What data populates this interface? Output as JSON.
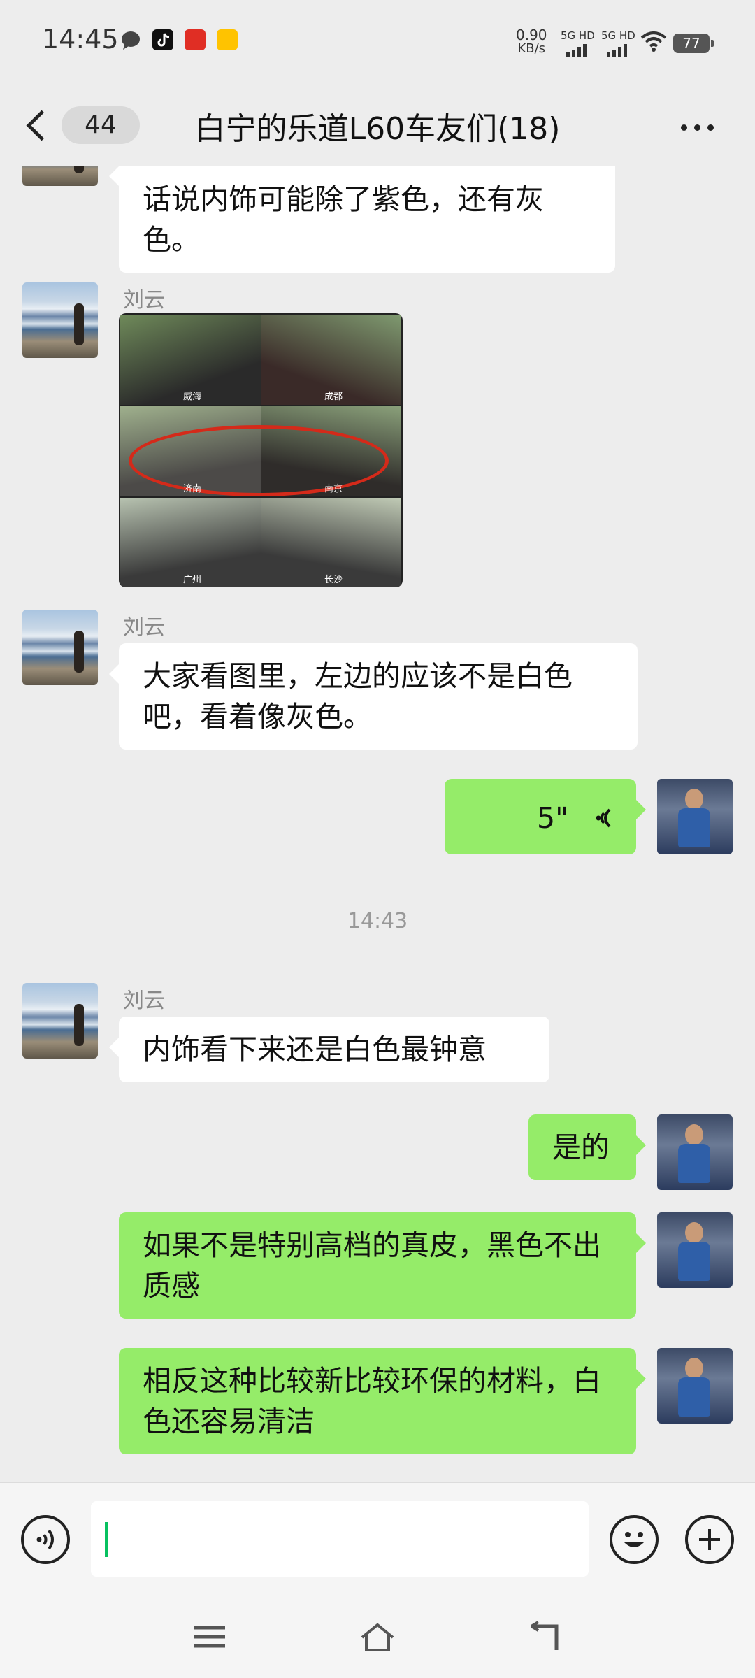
{
  "status_bar": {
    "time": "14:45",
    "network_speed_value": "0.90",
    "network_speed_unit": "KB/s",
    "signal_1_label": "5G HD",
    "signal_2_label": "5G HD",
    "battery_level": "77",
    "icons": [
      "chat-bubble-icon",
      "tiktok-icon",
      "pinduoduo-icon",
      "meituan-icon",
      "wifi-icon"
    ]
  },
  "header": {
    "unread_count": "44",
    "title": "白宁的乐道L60车友们(18)"
  },
  "messages": [
    {
      "side": "in",
      "text": "话说内饰可能除了紫色，还有灰色。"
    },
    {
      "side": "in",
      "sender": "刘云",
      "type": "image",
      "image_labels": [
        "威海",
        "成都",
        "济南",
        "南京",
        "广州",
        "长沙"
      ]
    },
    {
      "side": "in",
      "sender": "刘云",
      "text": "大家看图里，左边的应该不是白色吧，看着像灰色。"
    },
    {
      "side": "out",
      "type": "voice",
      "duration": "5\""
    },
    {
      "type": "time",
      "text": "14:43"
    },
    {
      "side": "in",
      "sender": "刘云",
      "text": "内饰看下来还是白色最钟意"
    },
    {
      "side": "out",
      "text": "是的"
    },
    {
      "side": "out",
      "text": "如果不是特别高档的真皮，黑色不出质感"
    },
    {
      "side": "out",
      "text": "相反这种比较新比较环保的材料，白色还容易清洁"
    }
  ],
  "colors": {
    "out_bubble": "#95ec69",
    "in_bubble": "#ffffff",
    "background": "#ededed",
    "caret": "#07c160"
  },
  "input": {
    "value": ""
  }
}
